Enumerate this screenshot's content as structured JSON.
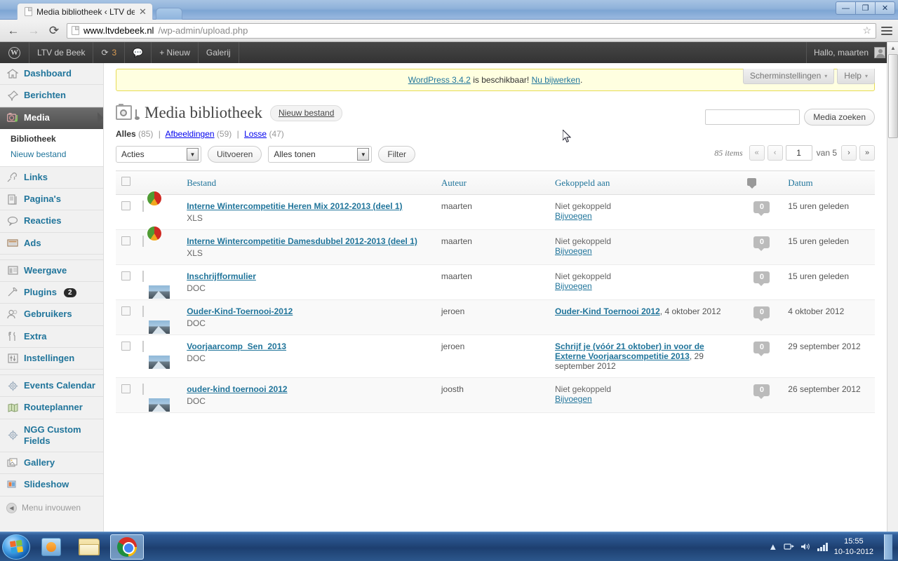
{
  "browser": {
    "tab_title": "Media bibliotheek ‹ LTV de",
    "tab_close": "✕",
    "url_domain": "www.ltvdebeek.nl",
    "url_path": "/wp-admin/upload.php",
    "back_icon": "←",
    "forward_icon": "→",
    "reload_icon": "⟳",
    "star_icon": "☆",
    "minimize": "—",
    "restore": "❐",
    "close": "✕"
  },
  "adminbar": {
    "logo": "W",
    "site_name": "LTV de Beek",
    "updates_icon": "⟳",
    "updates_count": "3",
    "comments_icon": "💬",
    "new_label": "+ Nieuw",
    "gallery_label": "Galerij",
    "greeting": "Hallo, maarten"
  },
  "sidebar": {
    "items": [
      {
        "label": "Dashboard",
        "icon": "dashboard-icon"
      },
      {
        "label": "Berichten",
        "icon": "posts-icon"
      },
      {
        "label": "Media",
        "icon": "media-icon",
        "current": true
      },
      {
        "label": "Links",
        "icon": "links-icon"
      },
      {
        "label": "Pagina's",
        "icon": "pages-icon"
      },
      {
        "label": "Reacties",
        "icon": "comments-icon"
      },
      {
        "label": "Ads",
        "icon": "ads-icon"
      },
      {
        "label": "Weergave",
        "icon": "appearance-icon"
      },
      {
        "label": "Plugins",
        "icon": "plugins-icon",
        "badge": "2"
      },
      {
        "label": "Gebruikers",
        "icon": "users-icon"
      },
      {
        "label": "Extra",
        "icon": "tools-icon"
      },
      {
        "label": "Instellingen",
        "icon": "settings-icon"
      },
      {
        "label": "Events Calendar",
        "icon": "gear-icon"
      },
      {
        "label": "Routeplanner",
        "icon": "map-icon"
      },
      {
        "label": "NGG Custom Fields",
        "icon": "gear-icon"
      },
      {
        "label": "Gallery",
        "icon": "gallery-icon"
      },
      {
        "label": "Slideshow",
        "icon": "slideshow-icon"
      }
    ],
    "submenu": [
      {
        "label": "Bibliotheek",
        "current": true
      },
      {
        "label": "Nieuw bestand",
        "current": false
      }
    ],
    "collapse_label": "Menu invouwen",
    "collapse_icon": "◀"
  },
  "notice": {
    "link_version": "WordPress 3.4.2",
    "middle": " is beschikbaar! ",
    "link_update": "Nu bijwerken",
    "end": "."
  },
  "screen_meta": {
    "screen_options": "Scherminstellingen",
    "help": "Help",
    "caret": "▾"
  },
  "header": {
    "title": "Media bibliotheek",
    "add_new": "Nieuw bestand"
  },
  "filters": {
    "all_label": "Alles",
    "all_count": "(85)",
    "images_label": "Afbeeldingen",
    "images_count": "(59)",
    "unattached_label": "Losse",
    "unattached_count": "(47)",
    "separator": "|"
  },
  "toolbar": {
    "bulk_action": "Acties",
    "apply_label": "Uitvoeren",
    "date_filter": "Alles tonen",
    "filter_label": "Filter",
    "search_value": "",
    "search_placeholder": "",
    "search_button": "Media zoeken"
  },
  "pagination": {
    "items_text": "85 items",
    "first": "«",
    "prev": "‹",
    "current_page": "1",
    "of_text": "van 5",
    "next": "›",
    "last": "»"
  },
  "table": {
    "headers": {
      "file": "Bestand",
      "author": "Auteur",
      "attached": "Gekoppeld aan",
      "comments": "comment-icon",
      "date": "Datum"
    },
    "rows": [
      {
        "title": "Interne Wintercompetitie Heren Mix 2012-2013 (deel 1)",
        "type": "XLS",
        "thumb": "xls",
        "author": "maarten",
        "attached_text": "Niet gekoppeld",
        "attached_is_link": false,
        "attach_action": "Bijvoegen",
        "attached_date": "",
        "comments": "0",
        "date": "15 uren geleden"
      },
      {
        "title": "Interne Wintercompetitie Damesdubbel 2012-2013 (deel 1)",
        "type": "XLS",
        "thumb": "xls",
        "author": "maarten",
        "attached_text": "Niet gekoppeld",
        "attached_is_link": false,
        "attach_action": "Bijvoegen",
        "attached_date": "",
        "comments": "0",
        "date": "15 uren geleden"
      },
      {
        "title": "Inschrijfformulier",
        "type": "DOC",
        "thumb": "doc",
        "author": "maarten",
        "attached_text": "Niet gekoppeld",
        "attached_is_link": false,
        "attach_action": "Bijvoegen",
        "attached_date": "",
        "comments": "0",
        "date": "15 uren geleden"
      },
      {
        "title": "Ouder-Kind-Toernooi-2012",
        "type": "DOC",
        "thumb": "doc",
        "author": "jeroen",
        "attached_text": "Ouder-Kind Toernooi 2012",
        "attached_is_link": true,
        "attach_action": "",
        "attached_date": ", 4 oktober 2012",
        "comments": "0",
        "date": "4 oktober 2012"
      },
      {
        "title": "Voorjaarcomp_Sen_2013",
        "type": "DOC",
        "thumb": "doc",
        "author": "jeroen",
        "attached_text": "Schrijf je (vóór 21 oktober) in voor de Externe Voorjaarscompetitie 2013",
        "attached_is_link": true,
        "attach_action": "",
        "attached_date": ", 29 september 2012",
        "comments": "0",
        "date": "29 september 2012"
      },
      {
        "title": "ouder-kind toernooi 2012",
        "type": "DOC",
        "thumb": "doc",
        "author": "joosth",
        "attached_text": "Niet gekoppeld",
        "attached_is_link": false,
        "attach_action": "Bijvoegen",
        "attached_date": "",
        "comments": "0",
        "date": "26 september 2012"
      }
    ]
  },
  "taskbar": {
    "start": "start-orb",
    "items": [
      "windows-media-player-icon",
      "file-explorer-icon",
      "google-chrome-icon"
    ],
    "tray_show_hidden": "▲",
    "tray_network": "network-icon",
    "tray_volume": "🔊",
    "tray_signal": "signal-icon",
    "clock_time": "15:55",
    "clock_date": "10-10-2012"
  },
  "colors": {
    "wp_link": "#21759b",
    "notice_bg": "#ffffe0",
    "notice_border": "#e6db55",
    "adminbar_bg": "#333333",
    "sidebar_bg": "#f1f1f1"
  }
}
